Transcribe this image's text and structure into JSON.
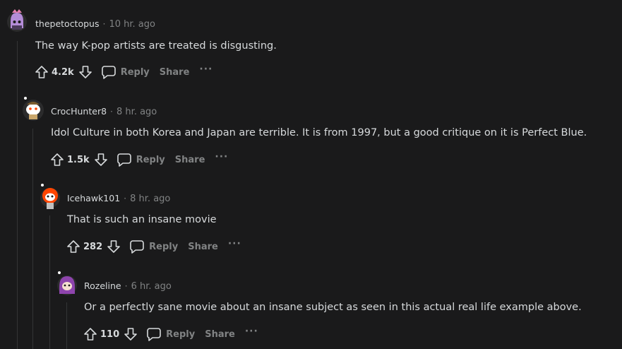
{
  "comments": [
    {
      "author": "thepetoctopus",
      "time": "10 hr. ago",
      "body": "The way K-pop artists are treated is disgusting.",
      "score": "4.2k",
      "avatar_color": "#9b59b6"
    },
    {
      "author": "CrocHunter8",
      "time": "8 hr. ago",
      "body": "Idol Culture in both Korea and Japan are terrible. It is from 1997, but a good critique on it is Perfect Blue.",
      "score": "1.5k",
      "avatar_color": "#ffffff"
    },
    {
      "author": "Icehawk101",
      "time": "8 hr. ago",
      "body": "That is such an insane movie",
      "score": "282",
      "avatar_color": "#ff4500"
    },
    {
      "author": "Rozeline",
      "time": "6 hr. ago",
      "body": "Or a perfectly sane movie about an insane subject as seen in this actual real life example above.",
      "score": "110",
      "avatar_color": "#8e44ad"
    }
  ],
  "labels": {
    "dot": "·",
    "reply": "Reply",
    "share": "Share",
    "more": "···"
  },
  "icons": {
    "upvote": "upvote-icon",
    "downvote": "downvote-icon",
    "reply": "comment-bubble-icon"
  }
}
